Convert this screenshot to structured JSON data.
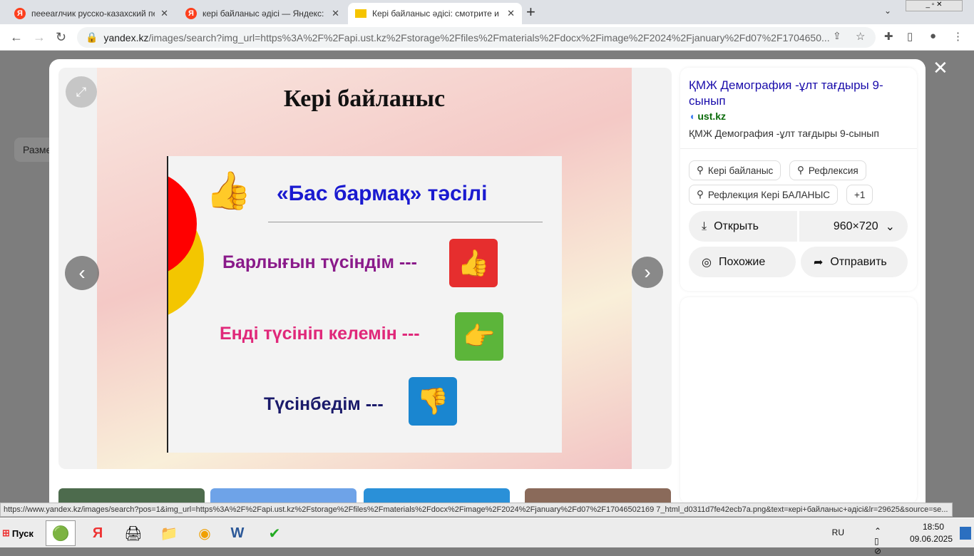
{
  "tabs": [
    {
      "title": "пееearлчик русско-казахский пере",
      "icon": "yandex-icon"
    },
    {
      "title": "кері байланыс әдісі — Яндекс: наш",
      "icon": "yandex-icon"
    },
    {
      "title": "Кері байланыс әдісі: смотрите и ск",
      "icon": "image-icon",
      "active": true
    }
  ],
  "address": {
    "domain": "yandex.kz",
    "path": "/images/search?img_url=https%3A%2F%2Fapi.ust.kz%2Fstorage%2Ffiles%2Fmaterials%2Fdocx%2Fimage%2F2024%2Fjanuary%2Fd07%2F1704650..."
  },
  "background": {
    "filter_label": "Разме"
  },
  "slide": {
    "title": "Кері байланыс",
    "subtitle": "«Бас бармақ» тәсілі",
    "rows": [
      {
        "text": "Барлығын түсіндім ---",
        "color": "#8a1a8a",
        "icon_color": "#e62e2e",
        "icon": "thumbs-up-icon"
      },
      {
        "text": "Енді түсініп келемін ---",
        "color": "#e0287a",
        "icon_color": "#5cb53a",
        "icon": "thumb-sideways-icon"
      },
      {
        "text": "Түсінбедім ---",
        "color": "#1a1a6a",
        "icon_color": "#1a86d0",
        "icon": "thumbs-down-icon"
      }
    ]
  },
  "info": {
    "title": "ҚМЖ Демография -ұлт тағдыры 9-сынып",
    "source": "ust.kz",
    "description": "ҚМЖ Демография -ұлт тағдыры 9-сынып",
    "tags": [
      "Кері байланыс",
      "Рефлексия",
      "Рефлекция Кері БАЛАНЫС"
    ],
    "more_tags": "+1",
    "open_label": "Открыть",
    "size": "960×720",
    "similar_label": "Похожие",
    "share_label": "Отправить"
  },
  "status_url": "https://www.yandex.kz/images/search?pos=1&img_url=https%3A%2F%2Fapi.ust.kz%2Fstorage%2Ffiles%2Fmaterials%2Fdocx%2Fimage%2F2024%2Fjanuary%2Fd07%2F17046502169 7_html_d0311d7fe42ecb7a.png&text=кері+байланыс+әдісі&lr=29625&source=se...",
  "taskbar": {
    "start": "Пуск",
    "lang": "RU",
    "time": "18:50",
    "date": "09.06.2025"
  }
}
